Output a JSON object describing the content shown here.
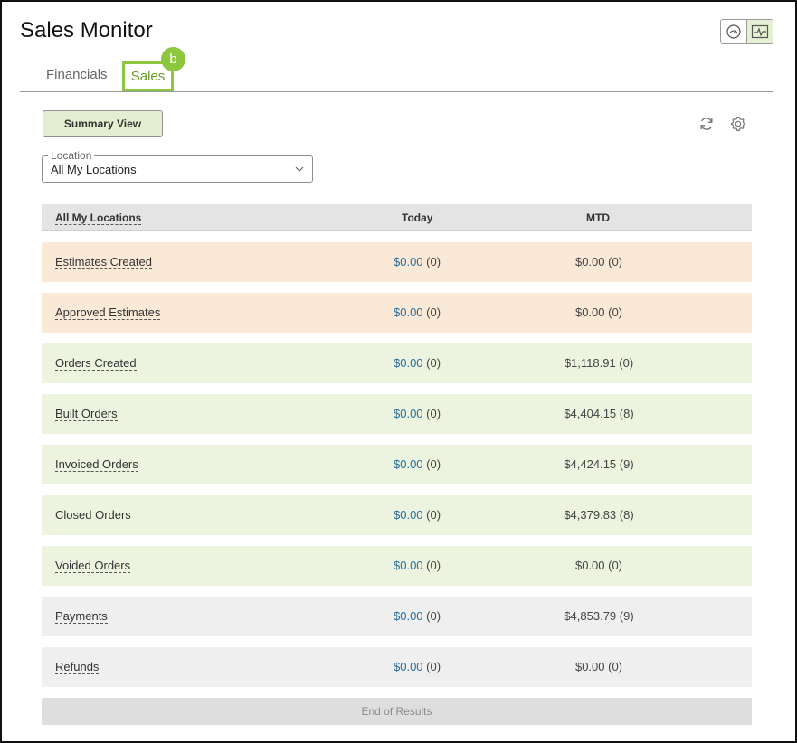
{
  "page": {
    "title": "Sales Monitor"
  },
  "view_toggle": {
    "items": [
      {
        "icon": "gauge-icon",
        "active": false
      },
      {
        "icon": "pulse-chart-icon",
        "active": true
      }
    ]
  },
  "tabs": [
    {
      "label": "Financials",
      "active": false
    },
    {
      "label": "Sales",
      "active": true,
      "badge": "b"
    }
  ],
  "toolbar": {
    "summary_label": "Summary View",
    "refresh_icon": "refresh-icon",
    "settings_icon": "gear-icon"
  },
  "location": {
    "label": "Location",
    "value": "All My Locations"
  },
  "table": {
    "headers": {
      "location": "All My Locations",
      "today": "Today",
      "mtd": "MTD"
    },
    "rows": [
      {
        "label": "Estimates Created",
        "today_amount": "$0.00",
        "today_count": "(0)",
        "mtd": "$0.00 (0)",
        "group": "estimate"
      },
      {
        "label": "Approved Estimates",
        "today_amount": "$0.00",
        "today_count": "(0)",
        "mtd": "$0.00 (0)",
        "group": "estimate"
      },
      {
        "label": "Orders Created",
        "today_amount": "$0.00",
        "today_count": "(0)",
        "mtd": "$1,118.91 (0)",
        "group": "order"
      },
      {
        "label": "Built Orders",
        "today_amount": "$0.00",
        "today_count": "(0)",
        "mtd": "$4,404.15 (8)",
        "group": "order"
      },
      {
        "label": "Invoiced Orders",
        "today_amount": "$0.00",
        "today_count": "(0)",
        "mtd": "$4,424.15 (9)",
        "group": "order"
      },
      {
        "label": "Closed Orders",
        "today_amount": "$0.00",
        "today_count": "(0)",
        "mtd": "$4,379.83 (8)",
        "group": "order"
      },
      {
        "label": "Voided Orders",
        "today_amount": "$0.00",
        "today_count": "(0)",
        "mtd": "$0.00 (0)",
        "group": "order"
      },
      {
        "label": "Payments",
        "today_amount": "$0.00",
        "today_count": "(0)",
        "mtd": "$4,853.79 (9)",
        "group": "payment"
      },
      {
        "label": "Refunds",
        "today_amount": "$0.00",
        "today_count": "(0)",
        "mtd": "$0.00 (0)",
        "group": "payment"
      }
    ],
    "end_text": "End of Results"
  },
  "colors": {
    "accent": "#8dc63f",
    "estimate_row": "#fbe9d8",
    "order_row": "#ecf4e0",
    "payment_row": "#efefef",
    "link": "#2b6d9a"
  }
}
